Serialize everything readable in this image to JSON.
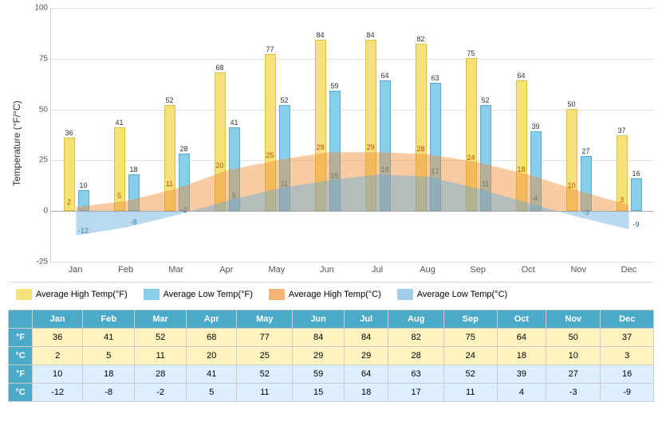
{
  "chart": {
    "yAxis": {
      "label": "Temperature (°F/°C)",
      "ticks": [
        100,
        75,
        50,
        25,
        0,
        -25
      ]
    },
    "xAxis": {
      "months": [
        "Jan",
        "Feb",
        "Mar",
        "Apr",
        "May",
        "Jun",
        "Jul",
        "Aug",
        "Sep",
        "Oct",
        "Nov",
        "Dec"
      ]
    },
    "legend": [
      {
        "id": "high-f",
        "label": "Average High Temp(°F)"
      },
      {
        "id": "low-f",
        "label": "Average Low Temp(°F)"
      },
      {
        "id": "high-c",
        "label": "Average High Temp(°C)"
      },
      {
        "id": "low-c",
        "label": "Average Low Temp(°C)"
      }
    ],
    "data": {
      "highF": [
        36,
        41,
        52,
        68,
        77,
        84,
        84,
        82,
        75,
        64,
        50,
        37
      ],
      "lowF": [
        10,
        18,
        28,
        41,
        52,
        59,
        64,
        63,
        52,
        39,
        27,
        16
      ],
      "highC": [
        2,
        5,
        11,
        20,
        25,
        29,
        29,
        28,
        24,
        18,
        10,
        3
      ],
      "lowC": [
        -12,
        -8,
        -2,
        5,
        11,
        15,
        18,
        17,
        11,
        4,
        -3,
        -9
      ]
    }
  },
  "table": {
    "rowLabels": [
      "°F",
      "°C",
      "°F",
      "°C"
    ],
    "rowTypes": [
      "row-high",
      "row-high",
      "row-low",
      "row-low"
    ],
    "months": [
      "Jan",
      "Feb",
      "Mar",
      "Apr",
      "May",
      "Jun",
      "Jul",
      "Aug",
      "Sep",
      "Oct",
      "Nov",
      "Dec"
    ],
    "rows": [
      [
        36,
        41,
        52,
        68,
        77,
        84,
        84,
        82,
        75,
        64,
        50,
        37
      ],
      [
        2,
        5,
        11,
        20,
        25,
        29,
        29,
        28,
        24,
        18,
        10,
        3
      ],
      [
        10,
        18,
        28,
        41,
        52,
        59,
        64,
        63,
        52,
        39,
        27,
        16
      ],
      [
        -12,
        -8,
        -2,
        5,
        11,
        15,
        18,
        17,
        11,
        4,
        -3,
        -9
      ]
    ]
  }
}
